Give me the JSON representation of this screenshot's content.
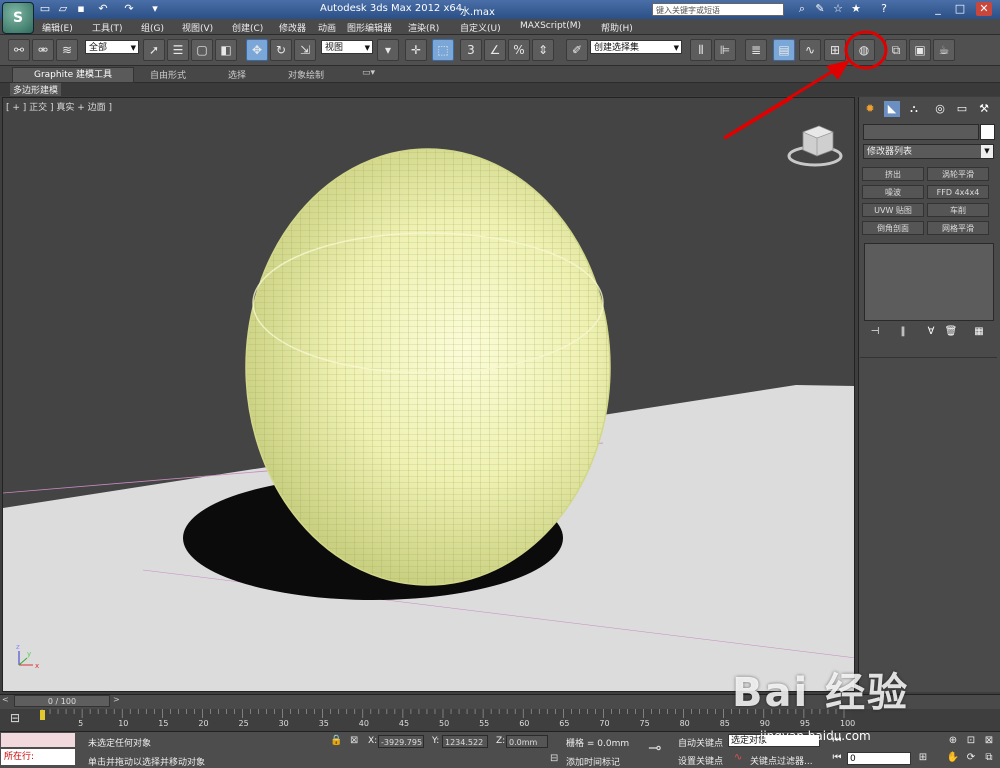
{
  "app": {
    "title": "Autodesk 3ds Max  2012 x64",
    "file": "水.max",
    "logo": "S",
    "search_placeholder": "键入关键字或短语"
  },
  "menu": [
    "编辑(E)",
    "工具(T)",
    "组(G)",
    "视图(V)",
    "创建(C)",
    "修改器",
    "动画",
    "图形编辑器",
    "渲染(R)",
    "自定义(U)",
    "MAXScript(M)",
    "帮助(H)"
  ],
  "toolbar": {
    "selection_filter": "全部",
    "ref_coord": "视图",
    "named_selection": "创建选择集"
  },
  "ribbon": {
    "tabs": [
      "Graphite 建模工具",
      "自由形式",
      "选择",
      "对象绘制"
    ],
    "subtab": "多边形建模"
  },
  "viewport": {
    "label": "[ + ] 正交 ] 真实 + 边面 ]",
    "ground_color": "#dcdcdc",
    "object_color": "#f0f3b8",
    "annotation_color": "#e00000"
  },
  "command_panel": {
    "modifier_list": "修改器列表",
    "modifiers": [
      "挤出",
      "涡轮平滑",
      "噪波",
      "FFD 4x4x4",
      "UVW 贴图",
      "车削",
      "倒角剖面",
      "网格平滑"
    ]
  },
  "timeline": {
    "slider": "0 / 100",
    "ticks": [
      "5",
      "10",
      "15",
      "20",
      "25",
      "30",
      "35",
      "40",
      "45",
      "50",
      "55",
      "60",
      "65",
      "70",
      "75",
      "80",
      "85",
      "90",
      "95",
      "100"
    ]
  },
  "status": {
    "script_label": "所在行:",
    "selection": "未选定任何对象",
    "prompt": "单击并拖动以选择并移动对象",
    "x_label": "X:",
    "x_value": "-3929.795",
    "y_label": "Y:",
    "y_value": "1234.522",
    "z_label": "Z:",
    "z_value": "0.0mm",
    "grid": "栅格 = 0.0mm",
    "add_time_tag": "添加时间标记",
    "auto_key": "自动关键点",
    "set_key": "设置关键点",
    "key_mode": "选定对象",
    "key_filters": "关键点过滤器...",
    "frame": "0"
  },
  "watermark": {
    "main": "Bai 经验",
    "sub": "jingyan.baidu.com"
  }
}
